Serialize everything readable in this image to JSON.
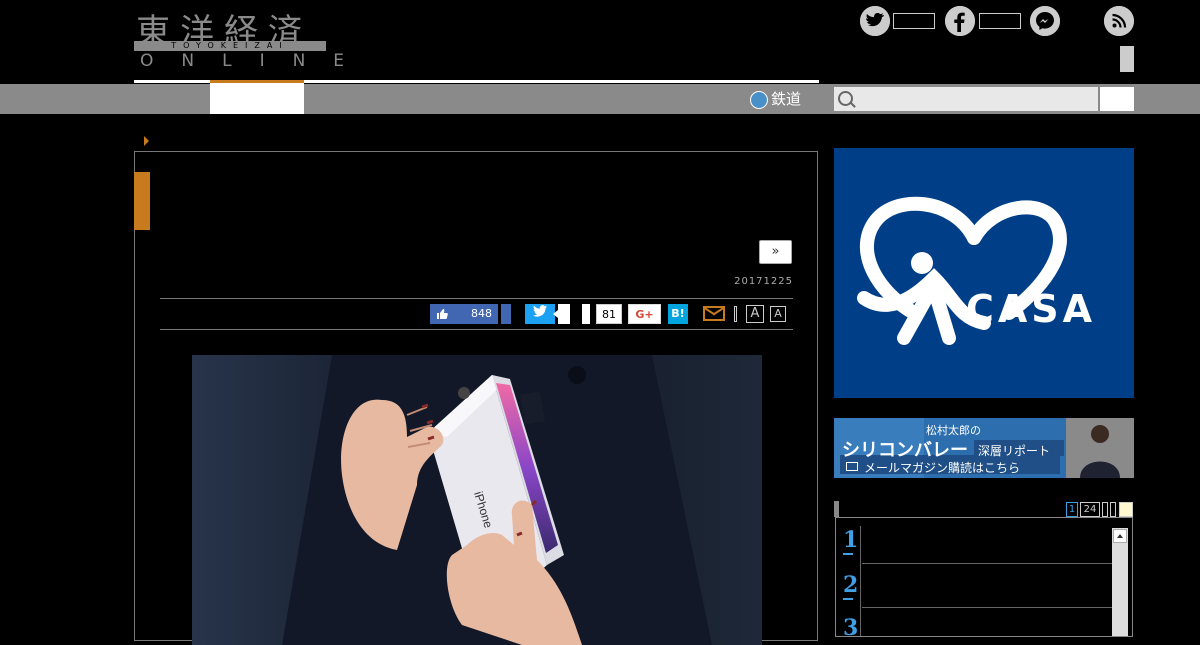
{
  "header": {
    "logo_kanji": "東洋経済",
    "logo_sub": "TOYOKEIZAI",
    "logo_online": "ONLINE"
  },
  "nav": {
    "rail_label": "鉄道"
  },
  "article": {
    "next_label": "»",
    "date": "20171225",
    "share": {
      "fb_count": "848",
      "pocket_count": "81",
      "gplus_label": "G+",
      "hatena_label": "B!",
      "font_large": "A",
      "font_small": "A"
    },
    "photo": {
      "box_label": "iPhone"
    }
  },
  "sidebar": {
    "ad_casa_text": "CASA",
    "banner": {
      "line1": "松村太郎の",
      "line2": "シリコンバレー",
      "line3": "深層リポート",
      "line4": "メールマガジン購読はこちら"
    },
    "ranking": {
      "tabs": [
        "1",
        "24"
      ],
      "numbers": [
        "1",
        "2",
        "3"
      ]
    }
  },
  "colors": {
    "accent": "#c87a1e",
    "nav_bar": "#8a8a8a",
    "casa_blue": "#003f87",
    "rank_blue": "#3fa0e6"
  }
}
